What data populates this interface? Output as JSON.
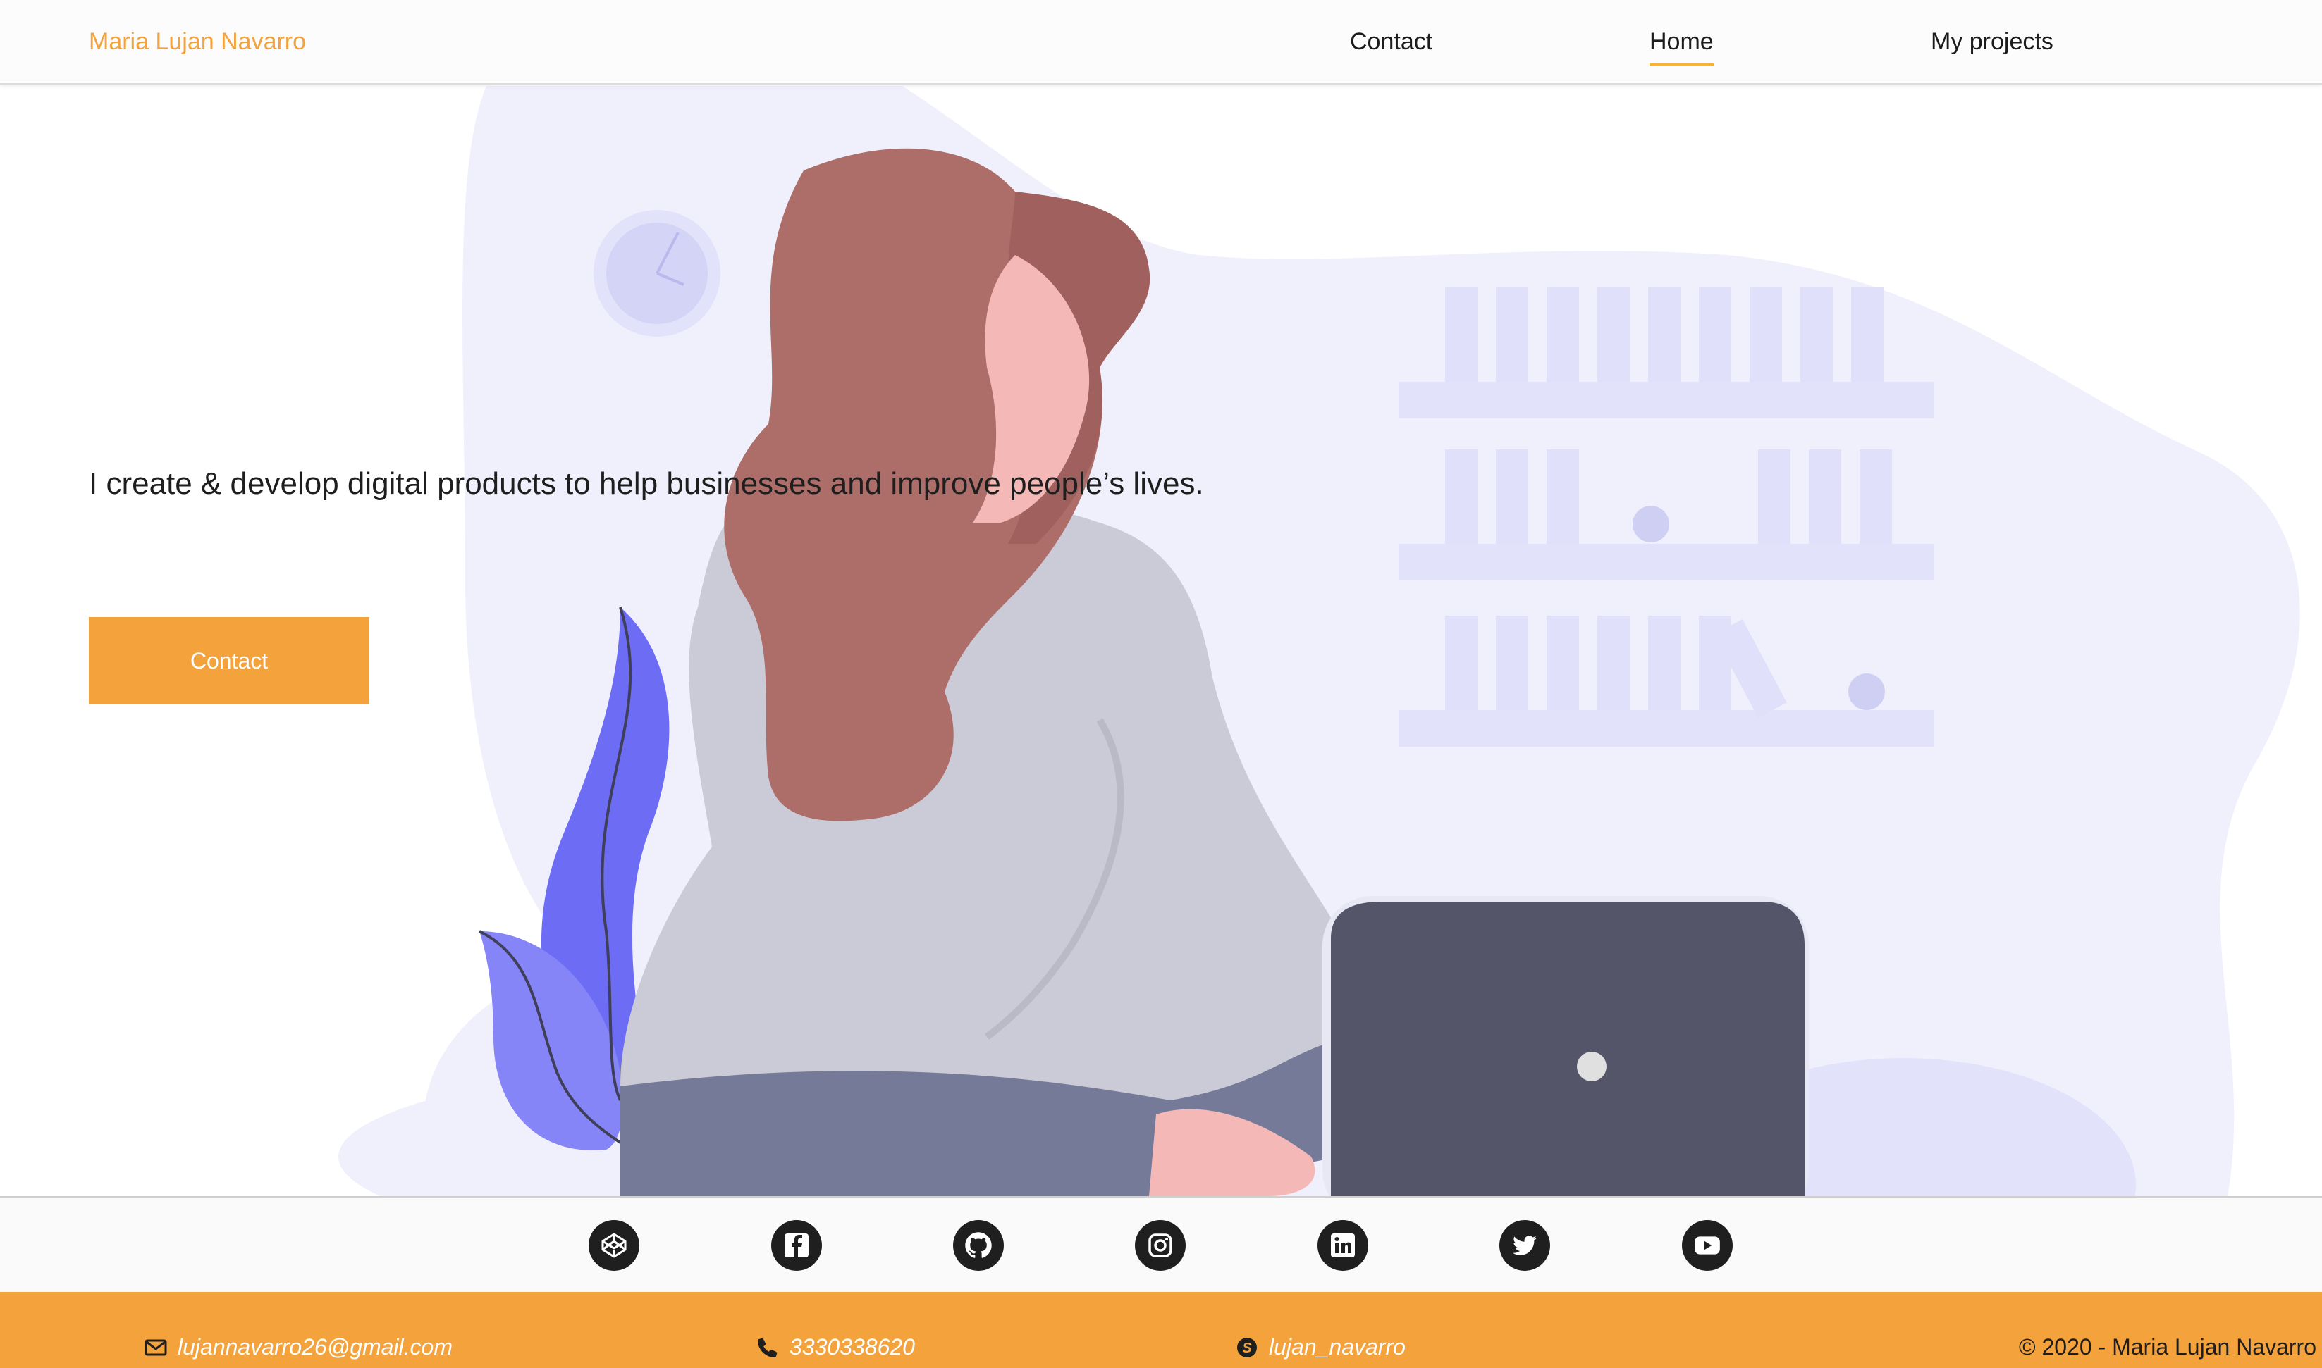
{
  "header": {
    "brand": "Maria Lujan Navarro",
    "nav": [
      {
        "label": "Contact"
      },
      {
        "label": "Home",
        "active": true
      },
      {
        "label": "My projects"
      }
    ]
  },
  "hero": {
    "tagline": "I create & develop digital products to help businesses and improve people’s lives.",
    "cta_label": "Contact"
  },
  "social": {
    "icons": [
      "codepen-icon",
      "facebook-icon",
      "github-icon",
      "instagram-icon",
      "linkedin-icon",
      "twitter-icon",
      "youtube-icon"
    ]
  },
  "footer": {
    "email": "lujannavarro26@gmail.com",
    "phone": "3330338620",
    "skype": "lujan_navarro",
    "copyright": "© 2020 - Maria Lujan Navarro"
  },
  "colors": {
    "accent": "#f4a23b",
    "nav_underline": "#f4b43b",
    "illustration_bg": "#f0f0fd"
  }
}
